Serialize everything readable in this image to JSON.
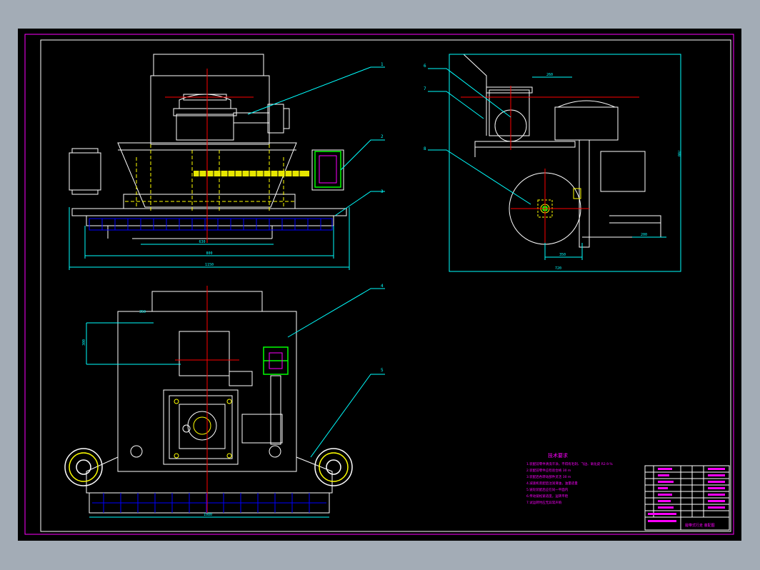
{
  "drawing": {
    "balloons": [
      "1",
      "2",
      "3",
      "4",
      "5",
      "6",
      "7",
      "8"
    ],
    "dims": {
      "front_inner": "630",
      "front_mid": "800",
      "front_overall": "1150",
      "side_height": "700",
      "side_width": "720",
      "side_sub_a": "350",
      "side_sub_b": "200",
      "side_top": "260",
      "plan_width": "1080",
      "plan_offset": "350",
      "plan_height": "300"
    },
    "notes": {
      "title": "技术要求",
      "lines": [
        "1.装配前零件清洗干净，不得有毛刺、飞边、氧化皮 R2.9.%",
        "2.装配前零件应检验合格 30 m",
        "3.装配后各转动部件灵活 30 m",
        "4.减速机装配后注润滑油，油量适量",
        "5.链轮装配后应在同一平面内",
        "6.传动链松紧适度，运转平稳",
        "7.试运转时应无异常声响"
      ]
    },
    "title_block": {
      "drawing_name": "履带式行走 装配图"
    }
  },
  "colors": {
    "sheet": "#000000",
    "border": "#ff00ff",
    "outline": "#ffffff",
    "hidden": "#ffff00",
    "center": "#ff0000",
    "dimension": "#00ffff",
    "tread": "#0000ff",
    "notes": "#ff00ff"
  }
}
